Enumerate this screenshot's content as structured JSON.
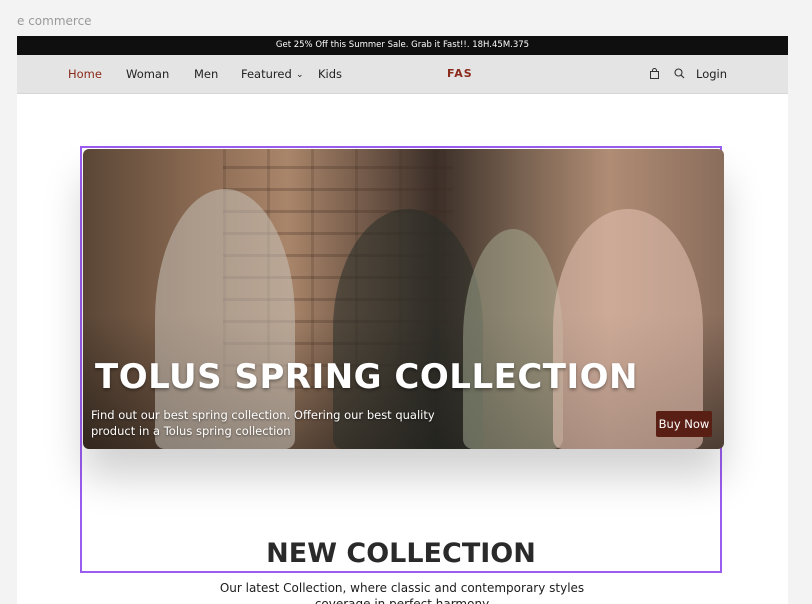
{
  "canvas": {
    "label": "e commerce"
  },
  "promo": {
    "text": "Get 25% Off this Summer Sale. Grab it Fast!!. 18H.45M.375"
  },
  "nav": {
    "links": [
      {
        "label": "Home",
        "active": true
      },
      {
        "label": "Woman"
      },
      {
        "label": "Men"
      },
      {
        "label": "Featured"
      },
      {
        "label": "Kids"
      }
    ],
    "brand": "FAS",
    "login_label": "Login",
    "icons": [
      "shopping-bag-icon",
      "search-icon",
      "chevron-down-icon"
    ]
  },
  "hero": {
    "title": "TOLUS SPRING COLLECTION",
    "subtitle": "Find out our best spring collection. Offering our best quality product in a Tolus spring collection",
    "cta_label": "Buy Now"
  },
  "collection": {
    "title": "NEW COLLECTION",
    "description": "Our latest Collection, where classic and contemporary styles coverage in perfect harmony"
  },
  "colors": {
    "accent": "#8a2a1a",
    "button": "#5a1f14",
    "selection_outline": "#9b5cf0",
    "promo_bg": "#0f0f0f",
    "nav_bg": "#e4e4e4"
  }
}
